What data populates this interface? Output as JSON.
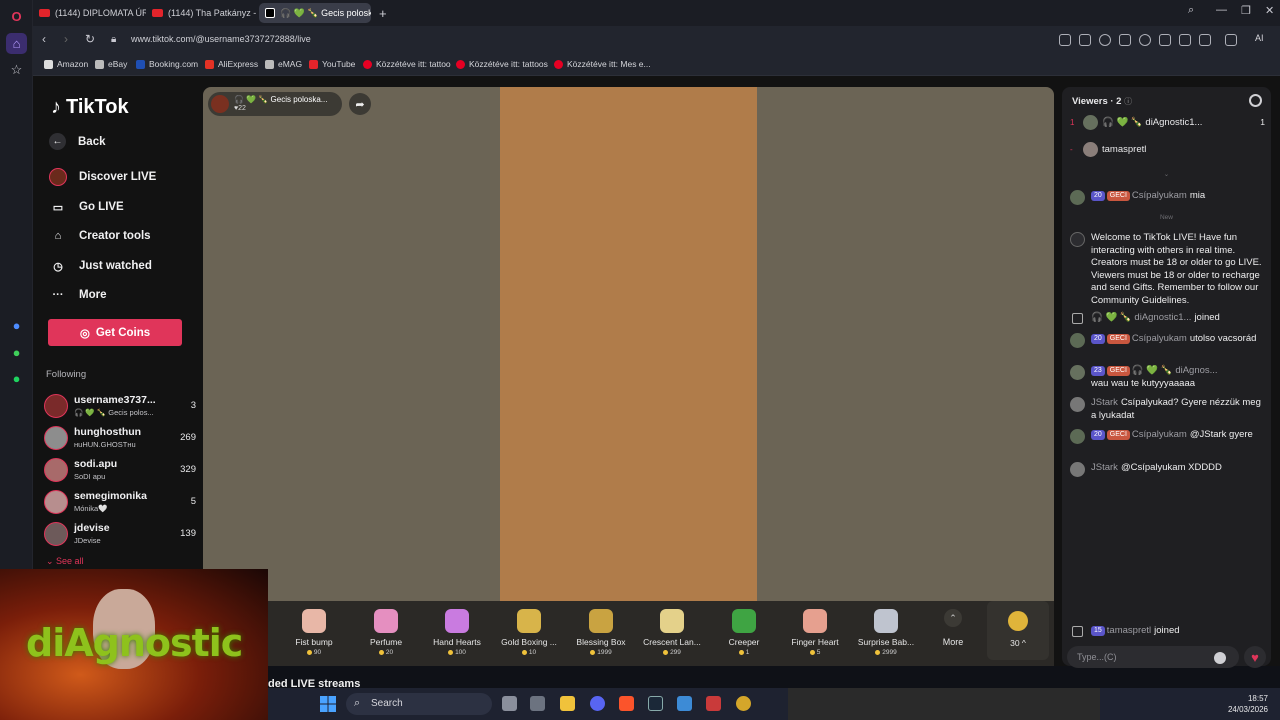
{
  "browser": {
    "tabs": [
      {
        "label": "(1144) DIPLOMATA ÚR - Y",
        "kind": "youtube"
      },
      {
        "label": "(1144) Tha Patkányz - Go",
        "kind": "youtube"
      },
      {
        "label": "🎧 💚 🍾 Gecis polosk",
        "kind": "tiktok"
      }
    ],
    "url": "www.tiktok.com/@username3737272888/live",
    "bookmarks": [
      "Amazon",
      "eBay",
      "Booking.com",
      "AliExpress",
      "eMAG",
      "YouTube",
      "Közzétéve itt: tattoo",
      "Közzétéve itt: tattoos",
      "Közzétéve itt: Mes e..."
    ],
    "ai_label": "AI"
  },
  "sidenav": {
    "logo": "TikTok",
    "items": [
      "Back",
      "Discover LIVE",
      "Go LIVE",
      "Creator tools",
      "Just watched",
      "More"
    ],
    "get_coins": "Get Coins",
    "following_label": "Following",
    "following": [
      {
        "name": "username3737...",
        "sub": "🎧 💚 🍾 Gecis polos...",
        "count": "3"
      },
      {
        "name": "hunghosthun",
        "sub": "ʜuHUN.GHOSTʜu",
        "count": "269"
      },
      {
        "name": "sodi.apu",
        "sub": "SoDI apu",
        "count": "329"
      },
      {
        "name": "semegimonika",
        "sub": "Mónika🤍",
        "count": "5"
      },
      {
        "name": "jdevise",
        "sub": "JDevise",
        "count": "139"
      }
    ],
    "see_all": "See all"
  },
  "stream": {
    "host_name": "🎧 💚 🍾 Gecis poloska...",
    "host_likes": "♥22",
    "gifts": [
      {
        "name": "Fist bump",
        "price": "90",
        "color": "#e8b7a7"
      },
      {
        "name": "Perfume",
        "price": "20",
        "color": "#e58fc0"
      },
      {
        "name": "Hand Hearts",
        "price": "100",
        "color": "#c97be0"
      },
      {
        "name": "Gold Boxing ...",
        "price": "10",
        "color": "#d8b44a"
      },
      {
        "name": "Blessing Box",
        "price": "1999",
        "color": "#c9a341"
      },
      {
        "name": "Crescent Lan...",
        "price": "299",
        "color": "#e4d18a"
      },
      {
        "name": "Creeper",
        "price": "1",
        "color": "#3fa443"
      },
      {
        "name": "Finger Heart",
        "price": "5",
        "color": "#e6a08f"
      },
      {
        "name": "Surprise Bab...",
        "price": "2999",
        "color": "#bfc4cf"
      }
    ],
    "more_label": "More",
    "coin_balance": "30 ^",
    "below_heading": "ded LIVE streams"
  },
  "chat": {
    "viewers_title": "Viewers · 2",
    "viewers": [
      {
        "rank": "1",
        "name": "🎧 💚 🍾 diAgnostic1...",
        "score": "1"
      },
      {
        "rank": "-",
        "name": "tamaspretl",
        "score": ""
      }
    ],
    "top_divider": "⌄",
    "new_divider": "New",
    "messages": [
      {
        "type": "user",
        "lvl": "20",
        "fan": "GECI",
        "user": "Csípalyukam",
        "text": "mia"
      },
      {
        "type": "system",
        "text": "Welcome to TikTok LIVE! Have fun interacting with others in real time. Creators must be 18 or older to go LIVE. Viewers must be 18 or older to recharge and send Gifts. Remember to follow our Community Guidelines."
      },
      {
        "type": "join",
        "user": "🎧 💚 🍾 diAgnostic1...",
        "text": "joined"
      },
      {
        "type": "user",
        "lvl": "20",
        "fan": "GECI",
        "user": "Csípalyukam",
        "text": "utolso vacsorád"
      },
      {
        "type": "user",
        "lvl": "23",
        "fan": "GECI",
        "user": "🎧 💚 🍾 diAgnos...",
        "text": "wau wau te kutyyyaaaaa"
      },
      {
        "type": "plain",
        "user": "JStark",
        "text": "Csípalyukad? Gyere nézzük meg a lyukadat"
      },
      {
        "type": "user",
        "lvl": "20",
        "fan": "GECI",
        "user": "Csípalyukam",
        "text": "@JStark gyere"
      },
      {
        "type": "plain",
        "user": "JStark",
        "text": "@Csípalyukam XDDDD"
      }
    ],
    "bottom_join": {
      "lvl": "15",
      "user": "tamaspretl",
      "text": "joined"
    },
    "input_placeholder": "Type...(C)"
  },
  "webcam_text": "diAgnostic",
  "taskbar": {
    "search": "Search",
    "time": "18:57",
    "date": "24/03/2026"
  }
}
